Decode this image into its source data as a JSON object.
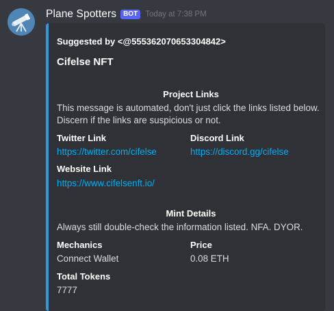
{
  "message": {
    "username": "Plane Spotters",
    "bot_tag": "BOT",
    "timestamp": "Today at 7:38 PM",
    "avatar_icon": "telescope-icon"
  },
  "embed": {
    "accent_color": "#3498db",
    "author": "Suggested by <@555362070653304842>",
    "title": "Cifelse NFT",
    "project_links": {
      "title": "Project Links",
      "description": "This message is automated, don't just click the links listed below. Discern if the links are suspicious or not."
    },
    "fields_links": [
      {
        "name": "Twitter Link",
        "value": "https://twitter.com/cifelse"
      },
      {
        "name": "Discord Link",
        "value": "https://discord.gg/cifelse"
      },
      {
        "name": "Website Link",
        "value": "https://www.cifelsenft.io/"
      }
    ],
    "mint_details": {
      "title": "Mint Details",
      "description": "Always still double-check the information listed. NFA. DYOR."
    },
    "fields_mint": [
      {
        "name": "Mechanics",
        "value": "Connect Wallet"
      },
      {
        "name": "Price",
        "value": "0.08 ETH"
      },
      {
        "name": "Total Tokens",
        "value": "7777"
      }
    ]
  }
}
